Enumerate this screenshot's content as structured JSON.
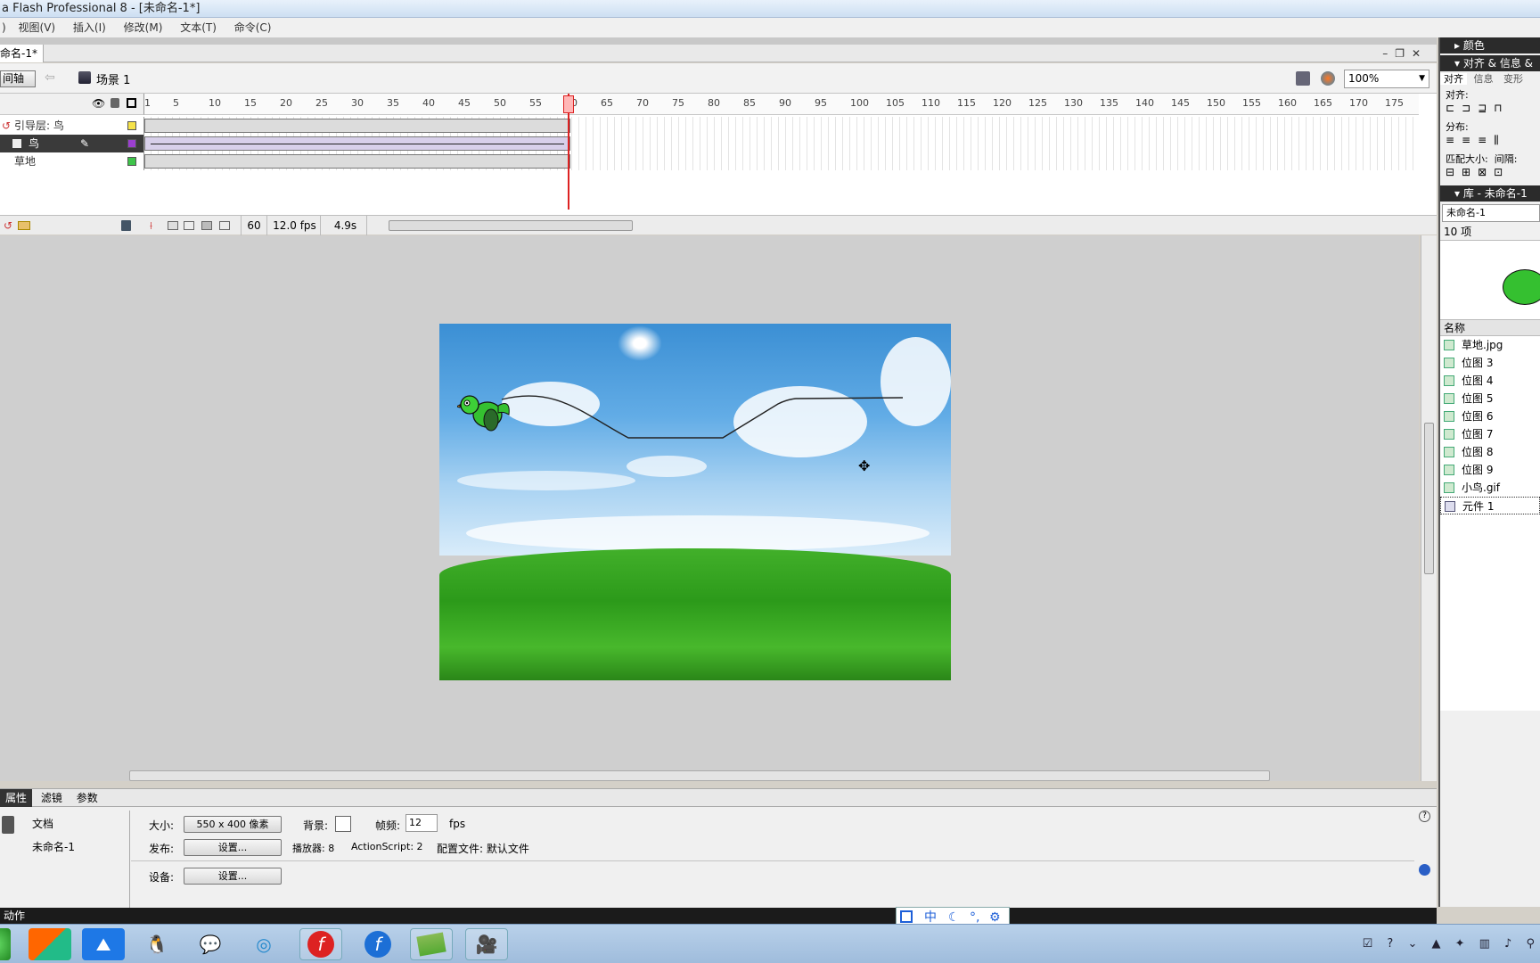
{
  "window": {
    "title": "a Flash Professional 8 - [未命名-1*]"
  },
  "menu": [
    "视图(V)",
    "插入(I)",
    "修改(M)",
    "文本(T)",
    "命令(C)"
  ],
  "doc_tab": "命名-1*",
  "scene": {
    "timeline_btn": "间轴",
    "scene_label": "场景 1",
    "zoom": "100%"
  },
  "timeline": {
    "ruler_labels": [
      "1",
      "5",
      "10",
      "15",
      "20",
      "25",
      "30",
      "35",
      "40",
      "45",
      "50",
      "55",
      "60",
      "65",
      "70",
      "75",
      "80",
      "85",
      "90",
      "95",
      "100",
      "105",
      "110",
      "115",
      "120",
      "125",
      "130",
      "135",
      "140",
      "145",
      "150",
      "155",
      "160",
      "165",
      "170",
      "175"
    ],
    "layers": [
      {
        "name": "引导层: 鸟",
        "color": "#f5e24a",
        "selected": false
      },
      {
        "name": "鸟",
        "color": "#9b3fd0",
        "selected": true
      },
      {
        "name": "草地",
        "color": "#3ec44a",
        "selected": false
      }
    ],
    "current_frame": "60",
    "fps": "12.0 fps",
    "time": "4.9s"
  },
  "properties": {
    "tabs": [
      "属性",
      "滤镜",
      "参数"
    ],
    "doc_label": "文档",
    "doc_name": "未命名-1",
    "size_label": "大小:",
    "size_btn": "550 x 400 像素",
    "bg_label": "背景:",
    "fps_label": "帧频:",
    "fps_value": "12",
    "fps_unit": "fps",
    "publish_label": "发布:",
    "settings_btn": "设置...",
    "player_label": "播放器: 8",
    "as_label": "ActionScript:  2",
    "profile_label": "配置文件:  默认文件",
    "device_label": "设备:",
    "device_btn": "设置..."
  },
  "actions_label": "动作",
  "right_panel": {
    "color_header": "颜色",
    "align_header": "对齐 & 信息 &",
    "align_tabs": [
      "对齐",
      "信息",
      "变形"
    ],
    "align_label": "对齐:",
    "dist_label": "分布:",
    "match_label": "匹配大小:",
    "spacing_label": "间隔:",
    "library_header": "库 - 未命名-1",
    "library_doc": "未命名-1",
    "item_count": "10 项",
    "name_header": "名称",
    "items": [
      "草地.jpg",
      "位图 3",
      "位图 4",
      "位图 5",
      "位图 6",
      "位图 7",
      "位图 8",
      "位图 9",
      "小鸟.gif",
      "元件 1"
    ]
  },
  "ime": {
    "lang": "中"
  },
  "icons": [
    "eye-icon",
    "lock-icon",
    "outline-icon",
    "trash-icon",
    "help-icon",
    "accessibility-icon",
    "qq-icon",
    "wechat-icon",
    "flash-icon"
  ]
}
